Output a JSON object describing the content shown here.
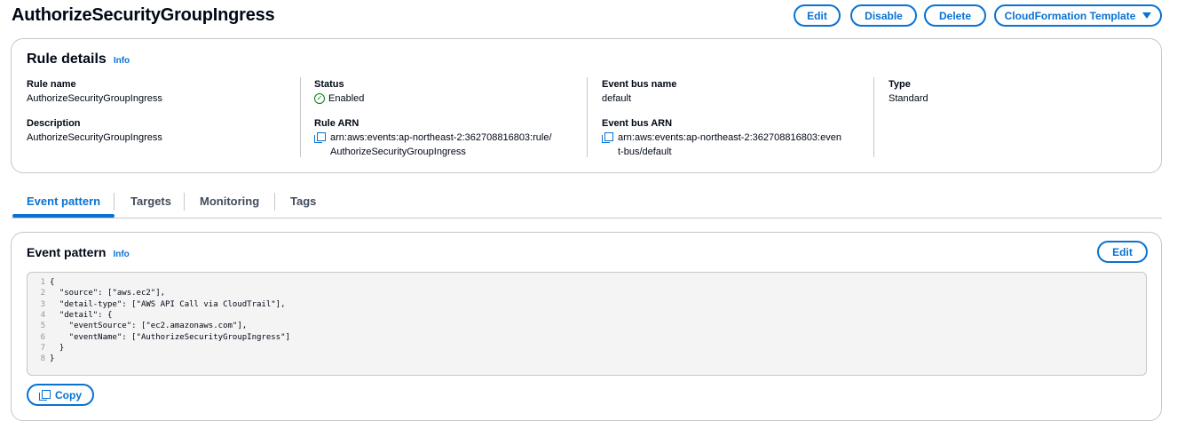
{
  "header": {
    "title": "AuthorizeSecurityGroupIngress",
    "edit_label": "Edit",
    "disable_label": "Disable",
    "delete_label": "Delete",
    "cfn_label": "CloudFormation Template"
  },
  "rule_details": {
    "title": "Rule details",
    "info": "Info",
    "rule_name_label": "Rule name",
    "rule_name": "AuthorizeSecurityGroupIngress",
    "description_label": "Description",
    "description": "AuthorizeSecurityGroupIngress",
    "status_label": "Status",
    "status": "Enabled",
    "rule_arn_label": "Rule ARN",
    "rule_arn_line1": "arn:aws:events:ap-northeast-2:362708816803:rule/",
    "rule_arn_line2": "AuthorizeSecurityGroupIngress",
    "event_bus_name_label": "Event bus name",
    "event_bus_name": "default",
    "event_bus_arn_label": "Event bus ARN",
    "event_bus_arn_line1": "arn:aws:events:ap-northeast-2:362708816803:even",
    "event_bus_arn_line2": "t-bus/default",
    "type_label": "Type",
    "type": "Standard"
  },
  "tabs": [
    {
      "label": "Event pattern",
      "active": true
    },
    {
      "label": "Targets",
      "active": false
    },
    {
      "label": "Monitoring",
      "active": false
    },
    {
      "label": "Tags",
      "active": false
    }
  ],
  "event_pattern": {
    "title": "Event pattern",
    "info": "Info",
    "edit_label": "Edit",
    "copy_label": "Copy",
    "code_lines": [
      {
        "n": "1",
        "text": "{"
      },
      {
        "n": "2",
        "text": "  \"source\": [\"aws.ec2\"],"
      },
      {
        "n": "3",
        "text": "  \"detail-type\": [\"AWS API Call via CloudTrail\"],"
      },
      {
        "n": "4",
        "text": "  \"detail\": {"
      },
      {
        "n": "5",
        "text": "    \"eventSource\": [\"ec2.amazonaws.com\"],"
      },
      {
        "n": "6",
        "text": "    \"eventName\": [\"AuthorizeSecurityGroupIngress\"]"
      },
      {
        "n": "7",
        "text": "  }"
      },
      {
        "n": "8",
        "text": "}"
      }
    ]
  },
  "colors": {
    "accent": "#0972d3",
    "success": "#037f0c",
    "border": "#c6c6cd"
  }
}
